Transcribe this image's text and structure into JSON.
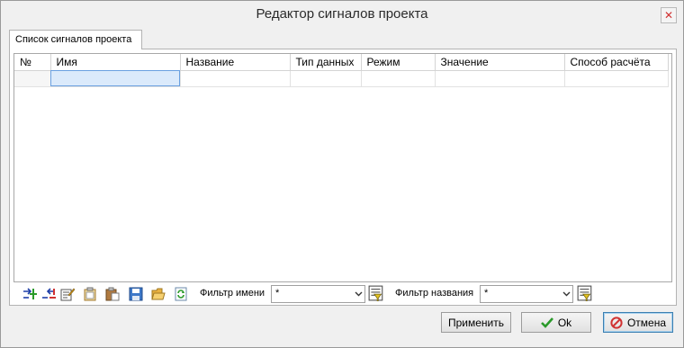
{
  "window": {
    "title": "Редактор сигналов проекта",
    "close_glyph": "✕"
  },
  "tabs": [
    {
      "label": "Список сигналов проекта"
    }
  ],
  "table": {
    "columns": [
      "№",
      "Имя",
      "Название",
      "Тип данных",
      "Режим",
      "Значение",
      "Способ расчёта"
    ],
    "rows": [
      [
        "",
        "",
        "",
        "",
        "",
        "",
        ""
      ]
    ]
  },
  "toolbar": {
    "icons": [
      "add-signal-icon",
      "remove-signal-icon",
      "edit-signal-icon",
      "copy-icon",
      "paste-icon",
      "save-icon",
      "open-folder-icon",
      "refresh-icon"
    ],
    "name_filter": {
      "label": "Фильтр имени",
      "value": "*"
    },
    "title_filter": {
      "label": "Фильтр названия",
      "value": "*"
    }
  },
  "buttons": {
    "apply": "Применить",
    "ok": "Ok",
    "cancel": "Отмена"
  },
  "colors": {
    "selection": "#dbeafb",
    "ok_check": "#2a9a2a",
    "cancel_icon": "#d03232"
  }
}
